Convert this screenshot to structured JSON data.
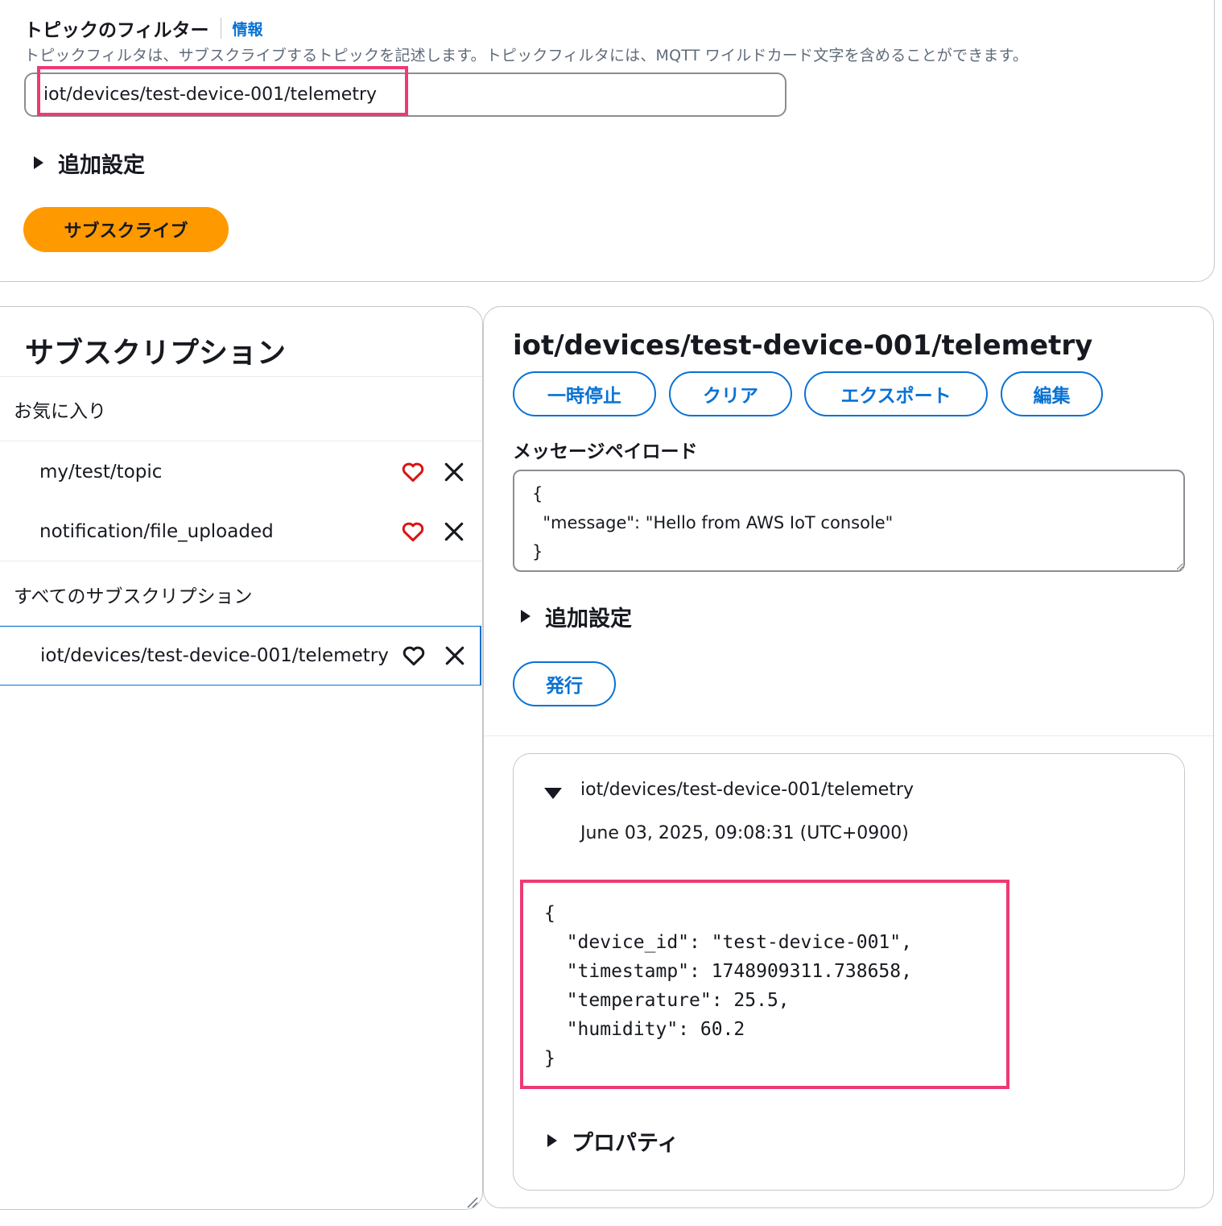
{
  "topic_filter": {
    "title": "トピックのフィルター",
    "info_link": "情報",
    "description": "トピックフィルタは、サブスクライブするトピックを記述します。トピックフィルタには、MQTT ワイルドカード文字を含めることができます。",
    "value": "iot/devices/test-device-001/telemetry",
    "additional_settings": "追加設定",
    "subscribe_button": "サブスクライブ"
  },
  "subscriptions": {
    "title": "サブスクリプション",
    "favorites_label": "お気に入り",
    "favorites": [
      {
        "topic": "my/test/topic",
        "favorited": true
      },
      {
        "topic": "notification/file_uploaded",
        "favorited": true
      }
    ],
    "all_label": "すべてのサブスクリプション",
    "all": [
      {
        "topic": "iot/devices/test-device-001/telemetry",
        "favorited": false,
        "selected": true
      }
    ]
  },
  "detail": {
    "topic_title": "iot/devices/test-device-001/telemetry",
    "buttons": {
      "pause": "一時停止",
      "clear": "クリア",
      "export": "エクスポート",
      "edit": "編集"
    },
    "payload_label": "メッセージペイロード",
    "payload_value": "{\n  \"message\": \"Hello from AWS IoT console\"\n}",
    "additional_settings": "追加設定",
    "publish_button": "発行",
    "message": {
      "topic": "iot/devices/test-device-001/telemetry",
      "timestamp": "June 03, 2025, 09:08:31 (UTC+0900)",
      "payload": "{\n  \"device_id\": \"test-device-001\",\n  \"timestamp\": 1748909311.738658,\n  \"temperature\": 25.5,\n  \"humidity\": 60.2\n}",
      "properties_label": "プロパティ"
    }
  },
  "colors": {
    "primary_orange": "#ff9900",
    "link_blue": "#0972d3",
    "highlight_pink": "#ec3b72",
    "favorite_red": "#d91515"
  },
  "icons": {
    "favorite": "heart-icon",
    "remove": "close-icon",
    "collapsed": "caret-right-icon",
    "expanded": "caret-down-icon"
  }
}
